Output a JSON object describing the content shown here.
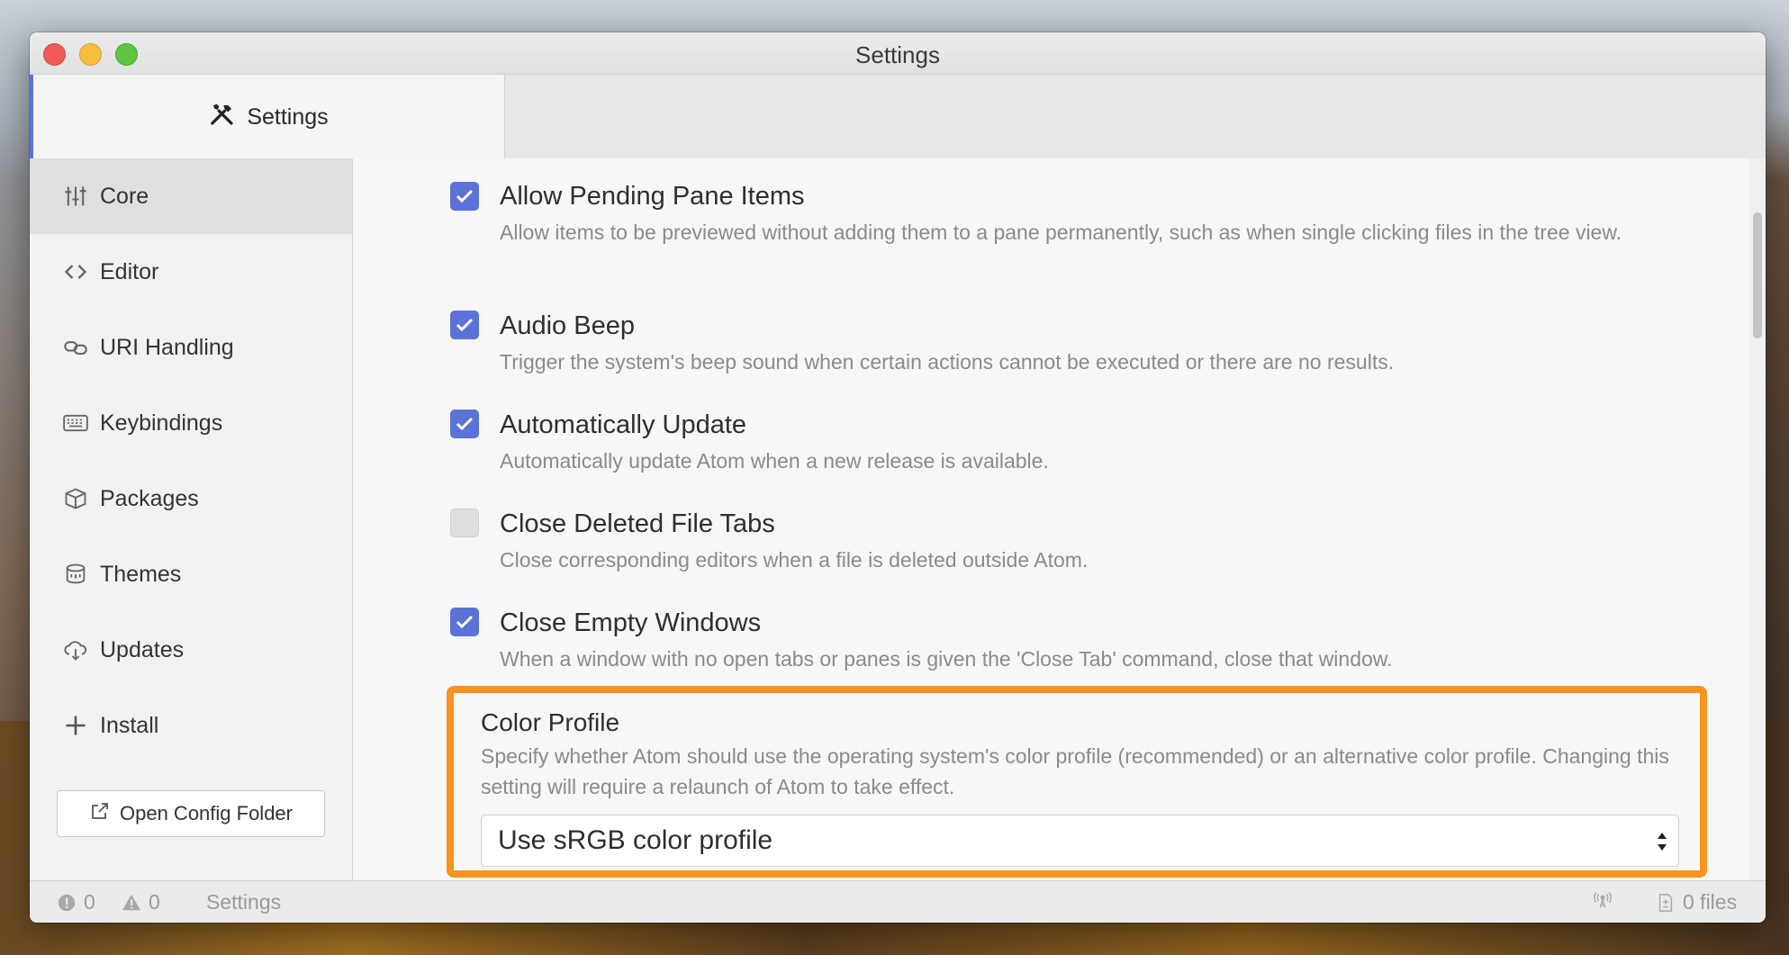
{
  "window": {
    "title": "Settings"
  },
  "tab": {
    "label": "Settings"
  },
  "sidebar": {
    "items": [
      {
        "label": "Core",
        "icon": "sliders-icon"
      },
      {
        "label": "Editor",
        "icon": "code-icon"
      },
      {
        "label": "URI Handling",
        "icon": "link-icon"
      },
      {
        "label": "Keybindings",
        "icon": "keyboard-icon"
      },
      {
        "label": "Packages",
        "icon": "package-icon"
      },
      {
        "label": "Themes",
        "icon": "paintcan-icon"
      },
      {
        "label": "Updates",
        "icon": "cloud-download-icon"
      },
      {
        "label": "Install",
        "icon": "plus-icon"
      }
    ],
    "config_button": "Open Config Folder"
  },
  "settings": [
    {
      "title": "Allow Pending Pane Items",
      "desc": "Allow items to be previewed without adding them to a pane permanently, such as when single clicking files in the tree view.",
      "checked": true
    },
    {
      "title": "Audio Beep",
      "desc": "Trigger the system's beep sound when certain actions cannot be executed or there are no results.",
      "checked": true
    },
    {
      "title": "Automatically Update",
      "desc": "Automatically update Atom when a new release is available.",
      "checked": true
    },
    {
      "title": "Close Deleted File Tabs",
      "desc": "Close corresponding editors when a file is deleted outside Atom.",
      "checked": false
    },
    {
      "title": "Close Empty Windows",
      "desc": "When a window with no open tabs or panes is given the 'Close Tab' command, close that window.",
      "checked": true
    }
  ],
  "color_profile": {
    "title": "Color Profile",
    "desc": "Specify whether Atom should use the operating system's color profile (recommended) or an alternative color profile. Changing this setting will require a relaunch of Atom to take effect.",
    "selected": "Use sRGB color profile"
  },
  "statusbar": {
    "errors": "0",
    "warnings": "0",
    "label": "Settings",
    "files": "0 files"
  },
  "colors": {
    "accent": "#5b72d6",
    "highlight": "#f7931e"
  }
}
